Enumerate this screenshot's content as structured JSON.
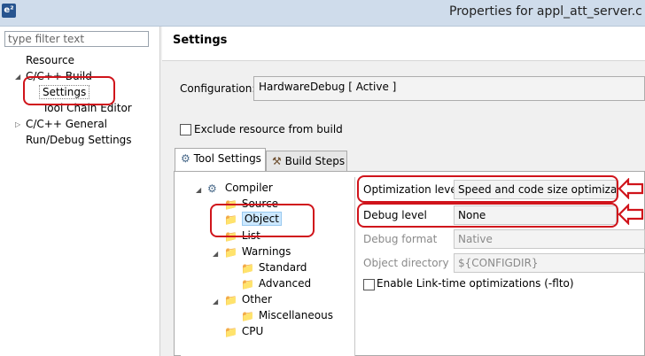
{
  "window": {
    "title": "Properties for appl_att_server.c",
    "app_icon": "e²"
  },
  "sidebar": {
    "filter_placeholder": "type filter text",
    "items": [
      {
        "label": "Resource"
      },
      {
        "label": "C/C++ Build"
      },
      {
        "label": "Settings"
      },
      {
        "label": "Tool Chain Editor"
      },
      {
        "label": "C/C++ General"
      },
      {
        "label": "Run/Debug Settings"
      }
    ]
  },
  "main": {
    "title": "Settings",
    "configuration_label": "Configuration:",
    "configuration_value": "HardwareDebug  [ Active ]",
    "exclude_label": "Exclude resource from build",
    "tabs": [
      {
        "label": "Tool Settings"
      },
      {
        "label": "Build Steps"
      }
    ],
    "tree": [
      {
        "label": "Compiler"
      },
      {
        "label": "Source"
      },
      {
        "label": "Object"
      },
      {
        "label": "List"
      },
      {
        "label": "Warnings"
      },
      {
        "label": "Standard"
      },
      {
        "label": "Advanced"
      },
      {
        "label": "Other"
      },
      {
        "label": "Miscellaneous"
      },
      {
        "label": "CPU"
      }
    ],
    "properties": {
      "optimization_label": "Optimization level",
      "optimization_value": "Speed and code size optimization",
      "debug_label": "Debug level",
      "debug_value": "None",
      "debug_format_label": "Debug format",
      "debug_format_value": "Native",
      "object_dir_label": "Object directory",
      "object_dir_value": "${CONFIGDIR}",
      "lto_label": "Enable Link-time optimizations (-flto)"
    }
  },
  "colors": {
    "annotation": "#d0141b",
    "titlebar": "#cfdceb",
    "selection": "#cce8ff"
  }
}
